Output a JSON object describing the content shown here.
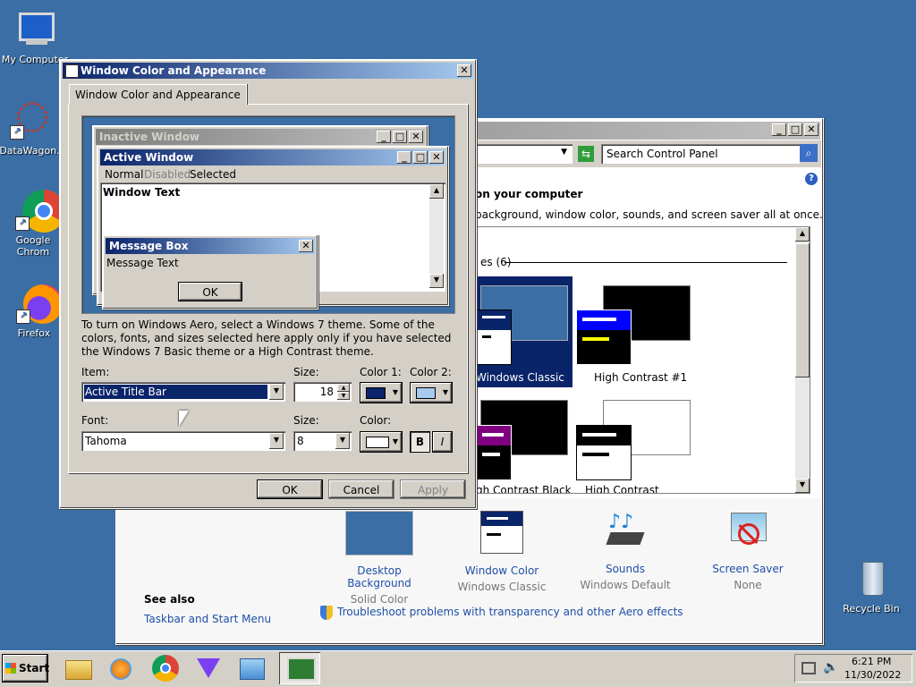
{
  "desktop": {
    "icons": [
      {
        "label": "My Computer",
        "icon": "computer-icon"
      },
      {
        "label": "DataWagon.",
        "icon": "datawagon-icon"
      },
      {
        "label": "Google Chrom",
        "icon": "chrome-icon"
      },
      {
        "label": "Firefox",
        "icon": "firefox-icon"
      },
      {
        "label": "Recycle Bin",
        "icon": "recycle-bin-icon"
      }
    ]
  },
  "control_panel": {
    "search_placeholder": "Search Control Panel",
    "heading": "on your computer",
    "description": "background, window color, sounds, and screen saver all at once.",
    "group_label": "es (6)",
    "themes": [
      {
        "label": "Windows Classic"
      },
      {
        "label": "High Contrast #1"
      },
      {
        "label": "gh Contrast Black"
      },
      {
        "label": "High Contrast White"
      }
    ],
    "bottom_items": [
      {
        "title": "Desktop Background",
        "sub": "Solid Color"
      },
      {
        "title": "Window Color",
        "sub": "Windows Classic"
      },
      {
        "title": "Sounds",
        "sub": "Windows Default"
      },
      {
        "title": "Screen Saver",
        "sub": "None"
      }
    ],
    "see_also": "See also",
    "taskbar_link": "Taskbar and Start Menu",
    "troubleshoot_link": "Troubleshoot problems with transparency and other Aero effects"
  },
  "dialog": {
    "title": "Window Color and Appearance",
    "tab": "Window Color and Appearance",
    "preview": {
      "inactive_title": "Inactive Window",
      "active_title": "Active Window",
      "menu": [
        "Normal",
        "Disabled",
        "Selected"
      ],
      "window_text": "Window Text",
      "message_title": "Message Box",
      "message_text": "Message Text",
      "ok": "OK"
    },
    "info": "To turn on Windows Aero, select a Windows 7 theme.  Some of the colors, fonts, and sizes selected here apply only if you have selected the Windows 7 Basic theme or a High Contrast theme.",
    "item_label": "Item:",
    "item_value": "Active Title Bar",
    "size_label": "Size:",
    "size_value": "18",
    "color1_label": "Color 1:",
    "color2_label": "Color 2:",
    "color1": "#0a246a",
    "color2": "#a6caf0",
    "font_label": "Font:",
    "font_value": "Tahoma",
    "font_size_label": "Size:",
    "font_size_value": "8",
    "font_color_label": "Color:",
    "bold": "B",
    "italic": "I",
    "ok": "OK",
    "cancel": "Cancel",
    "apply": "Apply"
  },
  "taskbar": {
    "start": "Start",
    "time": "6:21 PM",
    "date": "11/30/2022"
  }
}
